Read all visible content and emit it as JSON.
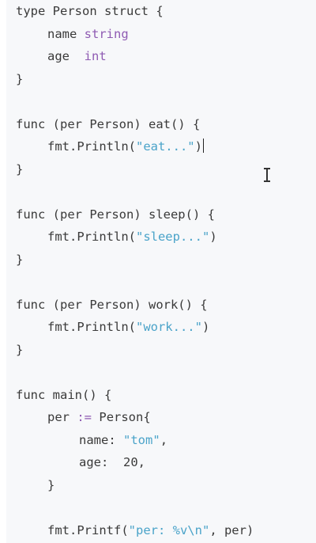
{
  "code": {
    "struct_line": {
      "kw": "type",
      "name": "Person",
      "kw2": "struct",
      "brace": "{"
    },
    "field_name": {
      "ident": "name",
      "type": "string"
    },
    "field_age": {
      "ident": "age",
      "type": "int"
    },
    "close": "}",
    "eat": {
      "func": "func",
      "sig": "(per Person) eat() {",
      "call": "fmt.Println(",
      "arg": "\"eat...\"",
      "close_paren": ")"
    },
    "sleep": {
      "func": "func",
      "sig": "(per Person) sleep() {",
      "call": "fmt.Println(",
      "arg": "\"sleep...\"",
      "close_paren": ")"
    },
    "work": {
      "func": "func",
      "sig": "(per Person) work() {",
      "call": "fmt.Println(",
      "arg": "\"work...\"",
      "close_paren": ")"
    },
    "main": {
      "func": "func",
      "sig": "main() {",
      "assign_lhs": "per",
      "assign_op": ":=",
      "assign_rhs": "Person{",
      "name_key": "name:",
      "name_val": "\"tom\"",
      "name_comma": ",",
      "age_key": "age:",
      "age_val": "20",
      "age_comma": ",",
      "literal_close": "}",
      "printf_call": "fmt.Printf(",
      "printf_fmt": "\"per: %v\\n\"",
      "printf_rest": ", per)"
    }
  },
  "colors": {
    "background": "#f7f8fa",
    "text": "#3a3a3a",
    "type": "#8f5bb3",
    "string": "#4aa3c9"
  },
  "cursor": {
    "caret_icon": "text-caret-icon",
    "pointer_icon": "i-beam-cursor-icon"
  }
}
